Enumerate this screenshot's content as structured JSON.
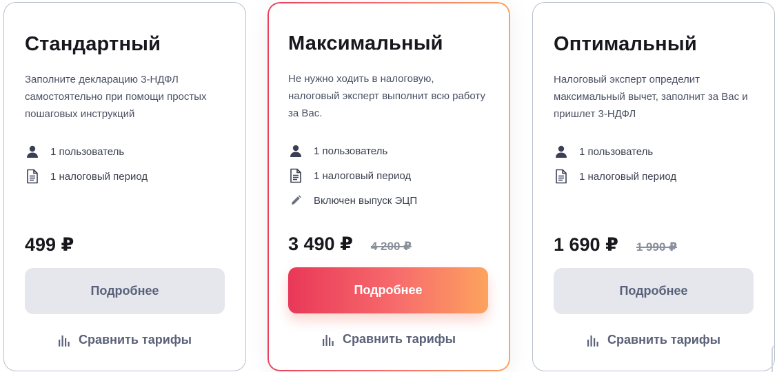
{
  "plans": [
    {
      "title": "Стандартный",
      "description": "Заполните декларацию 3-НДФЛ самостоятельно при помощи простых пошаговых инструкций",
      "features": [
        {
          "icon": "user-icon",
          "text": "1 пользователь"
        },
        {
          "icon": "document-icon",
          "text": "1 налоговый период"
        }
      ],
      "price": "499 ₽",
      "old_price": "",
      "button_label": "Подробнее",
      "compare_label": "Сравнить тарифы"
    },
    {
      "title": "Максимальный",
      "description": "Не нужно ходить в налоговую, налоговый эксперт выполнит всю работу за Вас.",
      "features": [
        {
          "icon": "user-icon",
          "text": "1 пользователь"
        },
        {
          "icon": "document-icon",
          "text": "1 налоговый период"
        },
        {
          "icon": "pencil-icon",
          "text": "Включен выпуск ЭЦП"
        }
      ],
      "price": "3 490 ₽",
      "old_price": "4 200 ₽",
      "button_label": "Подробнее",
      "compare_label": "Сравнить тарифы"
    },
    {
      "title": "Оптимальный",
      "description": "Налоговый эксперт определит максимальный вычет, заполнит за Вас и пришлет 3-НДФЛ",
      "features": [
        {
          "icon": "user-icon",
          "text": "1 пользователь"
        },
        {
          "icon": "document-icon",
          "text": "1 налоговый период"
        }
      ],
      "price": "1 690 ₽",
      "old_price": "1 990 ₽",
      "button_label": "Подробнее",
      "compare_label": "Сравнить тарифы"
    }
  ],
  "colors": {
    "accent_gradient_start": "#e93858",
    "accent_gradient_end": "#fda35e",
    "secondary_button_bg": "#e5e7ed",
    "secondary_button_text": "#59617a"
  }
}
